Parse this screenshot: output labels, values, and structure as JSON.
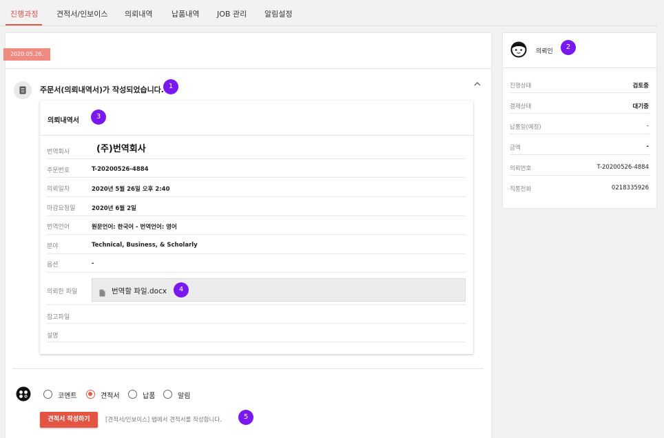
{
  "tabs": [
    {
      "label": "진행과정"
    },
    {
      "label": "견적서/인보이스"
    },
    {
      "label": "의뢰내역"
    },
    {
      "label": "납품내역"
    },
    {
      "label": "JOB 관리"
    },
    {
      "label": "알림설정"
    }
  ],
  "main": {
    "date_badge": "2020.05.26.",
    "order_title": "주문서(의뢰내역서)가 작성되었습니다.",
    "card_title": "의뢰내역서",
    "rows": [
      {
        "label": "번역회사",
        "value": "(주)번역회사"
      },
      {
        "label": "주문번호",
        "value": "T-20200526-4884"
      },
      {
        "label": "의뢰일자",
        "value": "2020년 5월 26일 오후 2:40"
      },
      {
        "label": "마감요청일",
        "value": "2020년 6월 2일"
      },
      {
        "label": "번역언어",
        "value": "원문언어: 한국어 - 번역언어: 영어"
      },
      {
        "label": "분야",
        "value": "Technical, Business, & Scholarly"
      },
      {
        "label": "옵션",
        "value": "-"
      },
      {
        "label": "의뢰한 파일",
        "value": "번역할 파일.docx"
      },
      {
        "label": "참고파일",
        "value": ""
      },
      {
        "label": "설명",
        "value": ""
      }
    ]
  },
  "composer": {
    "options": [
      {
        "label": "코멘트",
        "selected": false
      },
      {
        "label": "견적서",
        "selected": true
      },
      {
        "label": "납품",
        "selected": false
      },
      {
        "label": "알림",
        "selected": false
      }
    ],
    "button_label": "견적서 작성하기",
    "hint": "[견적서/인보이스] 탭에서 견적서를 작성합니다."
  },
  "side": {
    "title": "의뢰인",
    "rows": [
      {
        "label": "진행상태",
        "value": "검토중"
      },
      {
        "label": "결제상태",
        "value": "대기중"
      },
      {
        "label": "납품일(예정)",
        "value": "-"
      },
      {
        "label": "금액",
        "value": "-"
      },
      {
        "label": "의뢰번호",
        "value": "T-20200526-4884"
      },
      {
        "label": "직통전화",
        "value": "0218335926"
      }
    ]
  },
  "badges": [
    "1",
    "2",
    "3",
    "4",
    "5"
  ],
  "colors": {
    "accent": "#e05a4a",
    "badge": "#7a18f0",
    "date_badge": "#f08a80"
  },
  "icons": [
    "document-icon",
    "chevron-up-icon",
    "file-icon",
    "face-icon",
    "user-face-icon"
  ]
}
